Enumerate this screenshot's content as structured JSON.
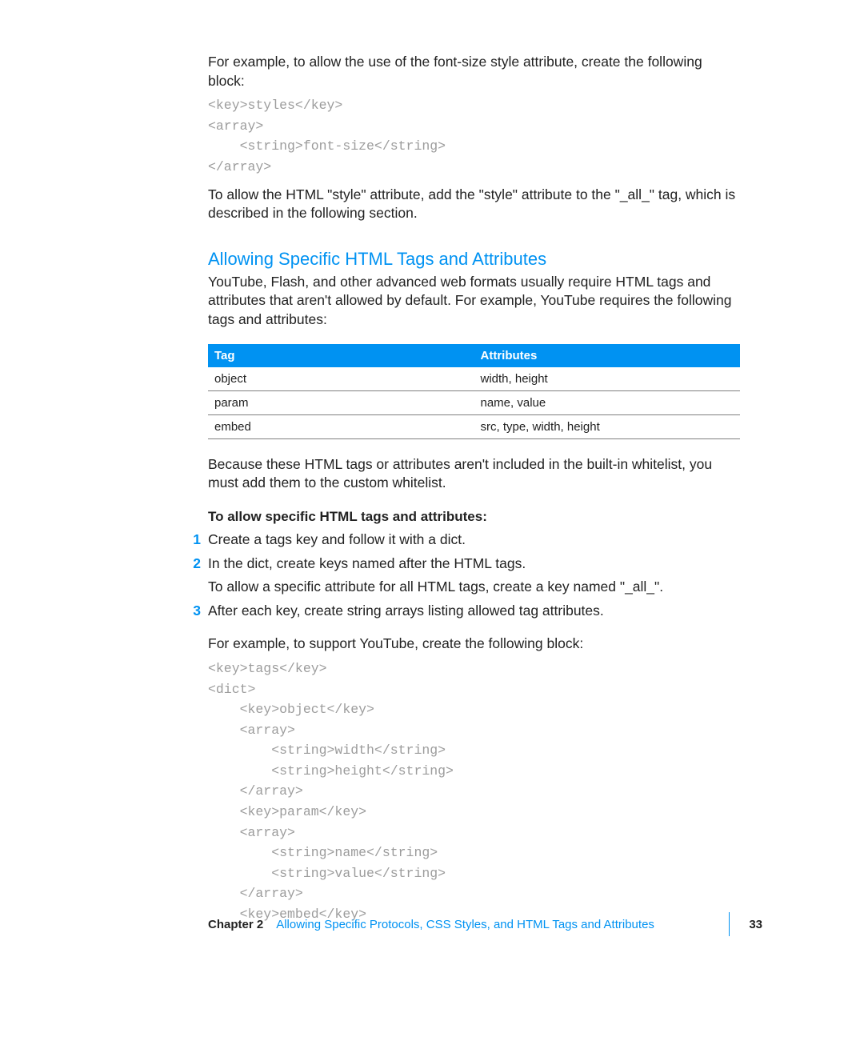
{
  "intro1": "For example, to allow the use of the font-size style attribute, create the following block:",
  "code1": "<key>styles</key>\n<array>\n    <string>font-size</string>\n</array>",
  "intro2": "To allow the HTML \"style\" attribute, add the \"style\" attribute to the \"_all_\" tag, which is described in the following section.",
  "heading1": "Allowing Specific HTML Tags and Attributes",
  "para1": "YouTube, Flash, and other advanced web formats usually require HTML tags and attributes that aren't allowed by default. For example, YouTube requires the following tags and attributes:",
  "table": {
    "head": {
      "c1": "Tag",
      "c2": "Attributes"
    },
    "rows": [
      {
        "c1": "object",
        "c2": "width, height"
      },
      {
        "c1": "param",
        "c2": "name, value"
      },
      {
        "c1": "embed",
        "c2": "src, type, width, height"
      }
    ]
  },
  "para2": "Because these HTML tags or attributes aren't included in the built-in whitelist, you must add them to the custom whitelist.",
  "sub1": "To allow specific HTML tags and attributes:",
  "steps": {
    "n1": "1",
    "t1": "Create a tags key and follow it with a dict.",
    "n2": "2",
    "t2a": "In the dict, create keys named after the HTML tags.",
    "t2b": "To allow a specific attribute for all HTML tags, create a key named \"_all_\".",
    "n3": "3",
    "t3a": "After each key, create string arrays listing allowed tag attributes.",
    "t3b": "For example, to support YouTube, create the following block:"
  },
  "code2": "<key>tags</key>\n<dict>\n    <key>object</key>\n    <array>\n        <string>width</string>\n        <string>height</string>\n    </array>\n    <key>param</key>\n    <array>\n        <string>name</string>\n        <string>value</string>\n    </array>\n    <key>embed</key>",
  "footer": {
    "chapter": "Chapter 2",
    "title": "Allowing Specific Protocols, CSS Styles, and HTML Tags and Attributes",
    "page": "33"
  }
}
